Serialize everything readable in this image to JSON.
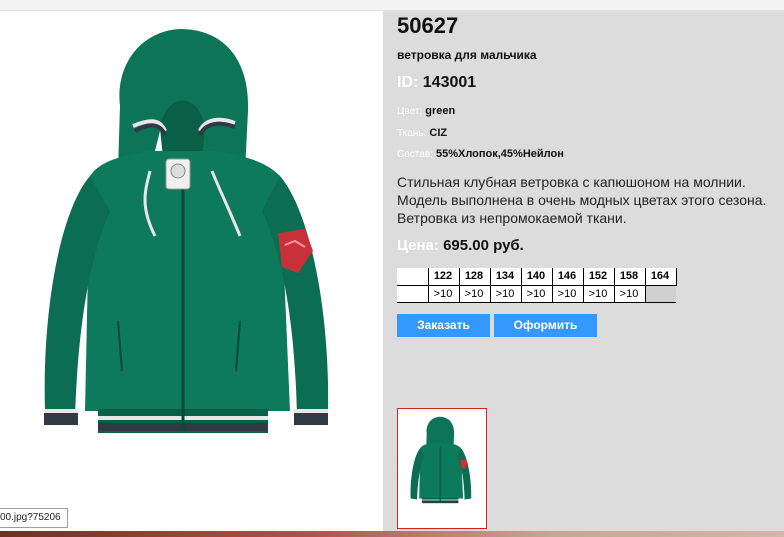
{
  "product": {
    "article": "50627",
    "name": "ветровка для мальчика",
    "id_label": "ID:",
    "id_value": "143001",
    "color_label": "Цвет:",
    "color_value": "green",
    "fabric_label": "Ткань:",
    "fabric_value": "CIZ",
    "composition_label": "Состав:",
    "composition_value": "55%Хлопок,45%Нейлон",
    "description": "Стильная клубная ветровка с капюшоном на молнии. Модель выполнена в очень модных цветах этого сезона. Ветровка из непромокаемой ткани.",
    "price_label": "Цена:",
    "price_value": "695.00 руб."
  },
  "sizes": {
    "headers": [
      "122",
      "128",
      "134",
      "140",
      "146",
      "152",
      "158",
      "164"
    ],
    "stock": [
      ">10",
      ">10",
      ">10",
      ">10",
      ">10",
      ">10",
      ">10",
      ""
    ]
  },
  "buttons": {
    "order": "Заказать",
    "checkout": "Оформить"
  },
  "status_tip": "00.jpg?75206",
  "colors": {
    "jacket": "#0d7a5c",
    "jacket_dark": "#0a5f47",
    "panel_bg": "#dcdcdc",
    "button_bg": "#3399ff",
    "thumb_border": "#cc2222",
    "badge": "#c8303a"
  },
  "icons": {
    "photo": "jacket-photo",
    "thumbnail": "jacket-thumbnail-icon"
  }
}
